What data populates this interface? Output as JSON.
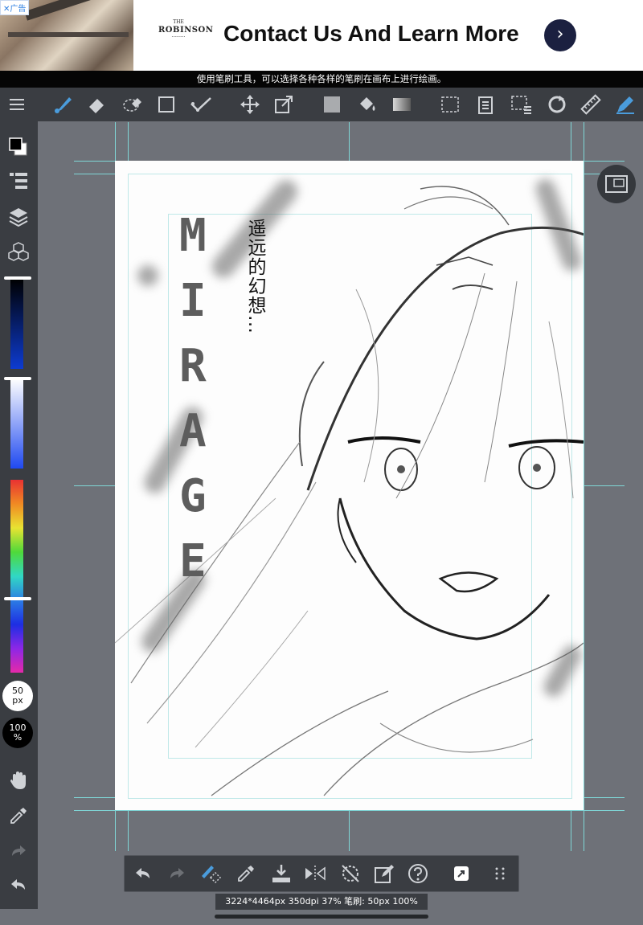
{
  "ad": {
    "badge": "✕广告",
    "logo_small": "THE",
    "logo_brand": "ROBINSON",
    "logo_sub": "·········",
    "title": "Contact Us And Learn More",
    "go_glyph": "›"
  },
  "hint": "使用笔刷工具，可以选择各种各样的笔刷在画布上进行绘画。",
  "toolbar": {
    "items": [
      "menu-icon",
      "brush-icon",
      "eraser-icon",
      "lasso-eraser-icon",
      "rectangle-icon",
      "checkmark-icon",
      "move-icon",
      "transform-icon",
      "fill-color-icon",
      "bucket-icon",
      "gradient-icon",
      "select-rect-icon",
      "copy-icon",
      "select-rect-menu-icon",
      "rotate-icon",
      "ruler-icon",
      "pen-icon"
    ],
    "accent": "#4a9cdc"
  },
  "sidebar": {
    "brush_size_value": "50",
    "brush_size_unit": "px",
    "opacity_value": "100",
    "opacity_unit": "%"
  },
  "canvas": {
    "title_letters": [
      "M",
      "I",
      "R",
      "A",
      "G",
      "E"
    ],
    "vertical_text": "遥远的幻想…"
  },
  "status": "3224*4464px 350dpi 37% 笔刷: 50px 100%"
}
